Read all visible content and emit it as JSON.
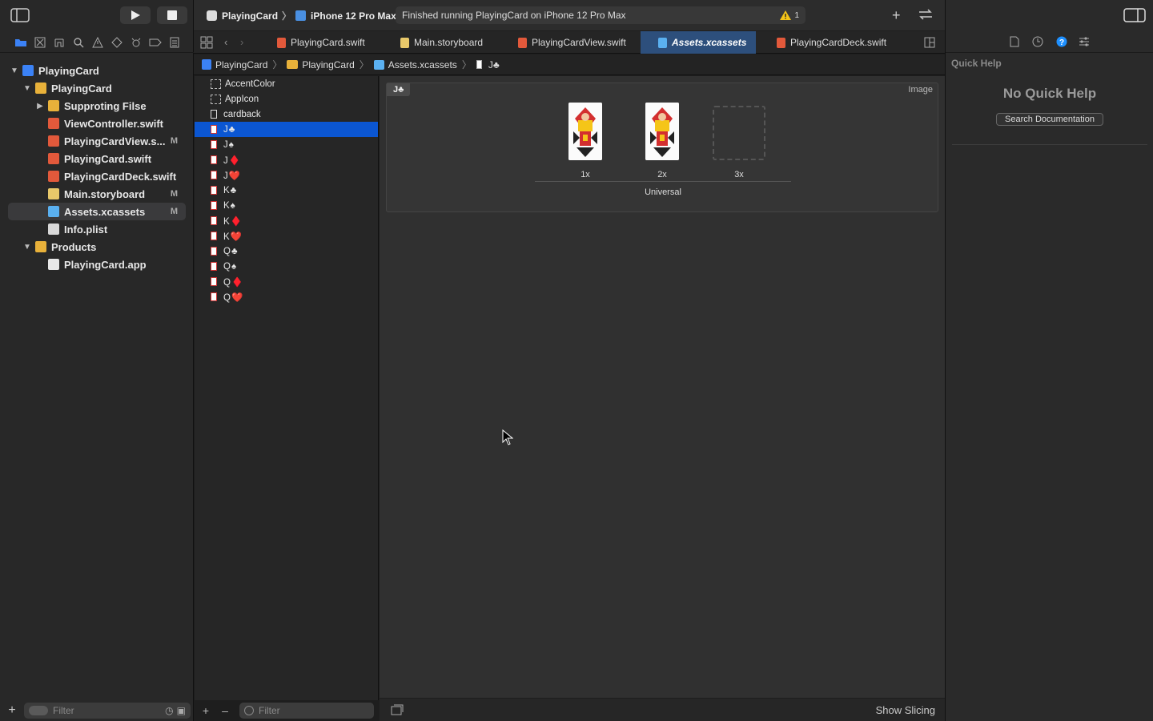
{
  "navigator": {
    "tree": [
      {
        "label": "PlayingCard",
        "level": 0,
        "disclosure": "open",
        "icon": "project-icon",
        "badge": "",
        "selected": false
      },
      {
        "label": "PlayingCard",
        "level": 1,
        "disclosure": "open",
        "icon": "folder-icon",
        "badge": "",
        "selected": false
      },
      {
        "label": "Supproting Filse",
        "level": 2,
        "disclosure": "closed",
        "icon": "folder-icon",
        "badge": "",
        "selected": false
      },
      {
        "label": "ViewController.swift",
        "level": 2,
        "disclosure": "",
        "icon": "swift-file-icon",
        "badge": "",
        "selected": false
      },
      {
        "label": "PlayingCardView.s...",
        "level": 2,
        "disclosure": "",
        "icon": "swift-file-icon",
        "badge": "M",
        "selected": false
      },
      {
        "label": "PlayingCard.swift",
        "level": 2,
        "disclosure": "",
        "icon": "swift-file-icon",
        "badge": "",
        "selected": false
      },
      {
        "label": "PlayingCardDeck.swift",
        "level": 2,
        "disclosure": "",
        "icon": "swift-file-icon",
        "badge": "",
        "selected": false
      },
      {
        "label": "Main.storyboard",
        "level": 2,
        "disclosure": "",
        "icon": "storyboard-icon",
        "badge": "M",
        "selected": false
      },
      {
        "label": "Assets.xcassets",
        "level": 2,
        "disclosure": "",
        "icon": "asset-catalog-icon",
        "badge": "M",
        "selected": true
      },
      {
        "label": "Info.plist",
        "level": 2,
        "disclosure": "",
        "icon": "plist-icon",
        "badge": "",
        "selected": false
      },
      {
        "label": "Products",
        "level": 1,
        "disclosure": "open",
        "icon": "folder-icon",
        "badge": "",
        "selected": false
      },
      {
        "label": "PlayingCard.app",
        "level": 2,
        "disclosure": "",
        "icon": "app-icon",
        "badge": "",
        "selected": false
      }
    ],
    "filter_placeholder": "Filter"
  },
  "toolbar": {
    "scheme_project": "PlayingCard",
    "scheme_device": "iPhone 12 Pro Max",
    "status_text": "Finished running PlayingCard on iPhone 12 Pro Max",
    "warning_count": "1"
  },
  "tabs": [
    {
      "label": "PlayingCard.swift",
      "active": false
    },
    {
      "label": "Main.storyboard",
      "active": false
    },
    {
      "label": "PlayingCardView.swift",
      "active": false
    },
    {
      "label": "Assets.xcassets",
      "active": true
    },
    {
      "label": "PlayingCardDeck.swift",
      "active": false
    }
  ],
  "breadcrumb": [
    "PlayingCard",
    "PlayingCard",
    "Assets.xcassets",
    "J♣"
  ],
  "assets": {
    "items": [
      {
        "label": "AccentColor",
        "type": "color",
        "selected": false
      },
      {
        "label": "AppIcon",
        "type": "appicon",
        "selected": false
      },
      {
        "label": "cardback",
        "type": "image",
        "selected": false
      },
      {
        "label": "J♣",
        "type": "image",
        "selected": true
      },
      {
        "label": "J♠",
        "type": "image",
        "selected": false
      },
      {
        "label": "J♦️",
        "type": "image",
        "selected": false
      },
      {
        "label": "J❤️",
        "type": "image",
        "selected": false
      },
      {
        "label": "K♣",
        "type": "image",
        "selected": false
      },
      {
        "label": "K♠",
        "type": "image",
        "selected": false
      },
      {
        "label": "K♦️",
        "type": "image",
        "selected": false
      },
      {
        "label": "K❤️",
        "type": "image",
        "selected": false
      },
      {
        "label": "Q♣",
        "type": "image",
        "selected": false
      },
      {
        "label": "Q♠",
        "type": "image",
        "selected": false
      },
      {
        "label": "Q♦️",
        "type": "image",
        "selected": false
      },
      {
        "label": "Q❤️",
        "type": "image",
        "selected": false
      }
    ],
    "filter_placeholder": "Filter"
  },
  "imageset": {
    "name": "J♣",
    "kind": "Image",
    "slots": [
      "1x",
      "2x",
      "3x"
    ],
    "group_label": "Universal"
  },
  "canvas": {
    "show_slicing_label": "Show Slicing"
  },
  "inspector": {
    "title": "Quick Help",
    "no_help": "No Quick Help",
    "search_button": "Search Documentation"
  },
  "colors": {
    "accent": "#0b56d2",
    "selected_tab": "#2d4f7c",
    "swift": "#e2593b",
    "folder": "#e8b13a"
  }
}
